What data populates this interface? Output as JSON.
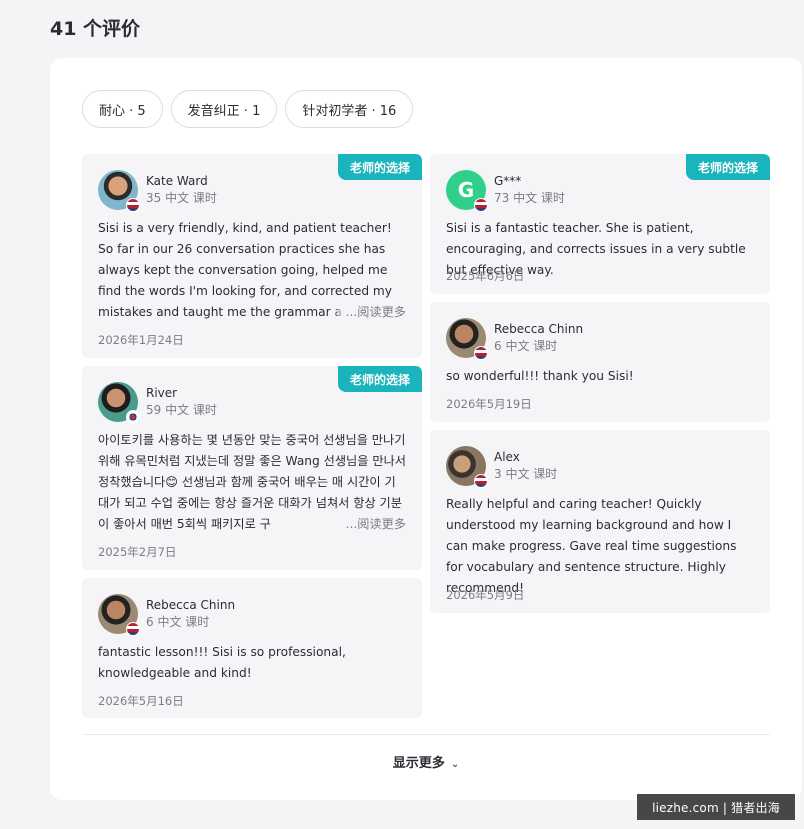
{
  "header": {
    "title": "41 个评价"
  },
  "filters": [
    {
      "label": "耐心 · 5"
    },
    {
      "label": "发音纠正 · 1"
    },
    {
      "label": "针对初学者 · 16"
    }
  ],
  "reviews": [
    {
      "badge": "老师的选择",
      "name": "Kate Ward",
      "lessons": "35 中文 课时",
      "text": "Sisi is a very friendly, kind, and patient teacher! So far in our 26 conversation practices she has always kept the conversation going, helped me find the words I'm looking for, and corrected my mistakes and taught me the grammar and vocab I need to have",
      "more": "...阅读更多",
      "date": "2026年1月24日",
      "flag": "us"
    },
    {
      "badge": "老师的选择",
      "name": "River",
      "lessons": "59 中文 课时",
      "text": "아이토키를 사용하는 몇 년동안 맞는 중국어 선생님을 만나기 위해 유목민처럼 지냈는데 정말 좋은 Wang 선생님을 만나서 정착했습니다😊 선생님과 함께 중국어 배우는 매 시간이 기대가 되고 수업 중에는 항상 즐거운 대화가 넘쳐서 항상 기분이 좋아서 매번 5회씩 패키지로 구",
      "more": "...阅读更多",
      "date": "2025年2月7日",
      "flag": "kr"
    },
    {
      "badge": "",
      "name": "Rebecca Chinn",
      "lessons": "6 中文 课时",
      "text": "fantastic lesson!!! Sisi is so professional, knowledgeable and kind!",
      "more": "",
      "date": "2026年5月16日",
      "flag": "us"
    },
    {
      "badge": "老师的选择",
      "name": "G***",
      "avatar_letter": "G",
      "lessons": "73 中文 课时",
      "text": "Sisi is a fantastic teacher. She is patient, encouraging, and corrects issues in a very subtle but effective way.",
      "more": "",
      "date": "2025年6月6日",
      "flag": "us"
    },
    {
      "badge": "",
      "name": "Rebecca Chinn",
      "lessons": "6 中文 课时",
      "text": "so wonderful!!! thank you Sisi!",
      "more": "",
      "date": "2026年5月19日",
      "flag": "us"
    },
    {
      "badge": "",
      "name": "Alex",
      "lessons": "3 中文 课时",
      "text": "Really helpful and caring teacher! Quickly understood my learning background and how I can make progress. Gave real time suggestions for vocabulary and sentence structure. Highly recommend!",
      "more": "",
      "date": "2026年5月9日",
      "flag": "us"
    }
  ],
  "show_more": {
    "label": "显示更多",
    "icon": "chevron-down-icon"
  },
  "watermark": {
    "text": "liezhe.com | 猎者出海"
  },
  "colors": {
    "accent": "#19b4bc",
    "avatar_letter_bg": "#2fd18a",
    "card_bg": "#f5f5f8"
  }
}
